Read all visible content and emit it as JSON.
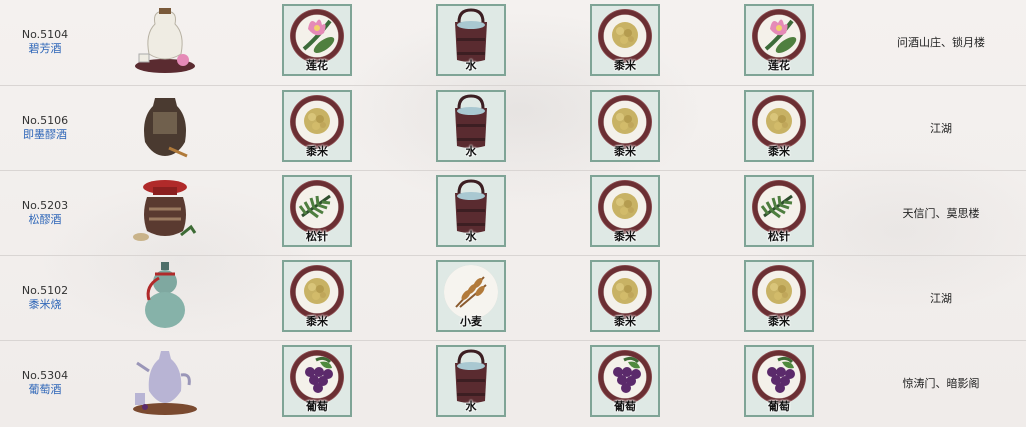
{
  "rows": [
    {
      "number": "No.5104",
      "name": "碧芳酒",
      "item_icon": "lotus-wine-icon",
      "ingredients": [
        {
          "label": "莲花",
          "icon": "lotus-icon"
        },
        {
          "label": "水",
          "icon": "water-bucket-icon"
        },
        {
          "label": "黍米",
          "icon": "millet-icon"
        },
        {
          "label": "莲花",
          "icon": "lotus-icon"
        }
      ],
      "source": "问酒山庄、锁月楼"
    },
    {
      "number": "No.5106",
      "name": "即墨醪酒",
      "item_icon": "jar-wine-icon",
      "ingredients": [
        {
          "label": "黍米",
          "icon": "millet-icon"
        },
        {
          "label": "水",
          "icon": "water-bucket-icon"
        },
        {
          "label": "黍米",
          "icon": "millet-icon"
        },
        {
          "label": "黍米",
          "icon": "millet-icon"
        }
      ],
      "source": "江湖"
    },
    {
      "number": "No.5203",
      "name": "松醪酒",
      "item_icon": "red-lid-jar-icon",
      "ingredients": [
        {
          "label": "松针",
          "icon": "pine-needle-icon"
        },
        {
          "label": "水",
          "icon": "water-bucket-icon"
        },
        {
          "label": "黍米",
          "icon": "millet-icon"
        },
        {
          "label": "松针",
          "icon": "pine-needle-icon"
        }
      ],
      "source": "天信门、莫思楼"
    },
    {
      "number": "No.5102",
      "name": "黍米烧",
      "item_icon": "gourd-bottle-icon",
      "ingredients": [
        {
          "label": "黍米",
          "icon": "millet-icon"
        },
        {
          "label": "小麦",
          "icon": "wheat-icon"
        },
        {
          "label": "黍米",
          "icon": "millet-icon"
        },
        {
          "label": "黍米",
          "icon": "millet-icon"
        }
      ],
      "source": "江湖"
    },
    {
      "number": "No.5304",
      "name": "葡萄酒",
      "item_icon": "wine-pot-icon",
      "ingredients": [
        {
          "label": "葡萄",
          "icon": "grape-icon"
        },
        {
          "label": "水",
          "icon": "water-bucket-icon"
        },
        {
          "label": "葡萄",
          "icon": "grape-icon"
        },
        {
          "label": "葡萄",
          "icon": "grape-icon"
        }
      ],
      "source": "惊涛门、暗影阁"
    }
  ],
  "colors": {
    "link": "#2e66b8",
    "frame": "#7fa496",
    "tile_bg": "#dfe9e5"
  }
}
